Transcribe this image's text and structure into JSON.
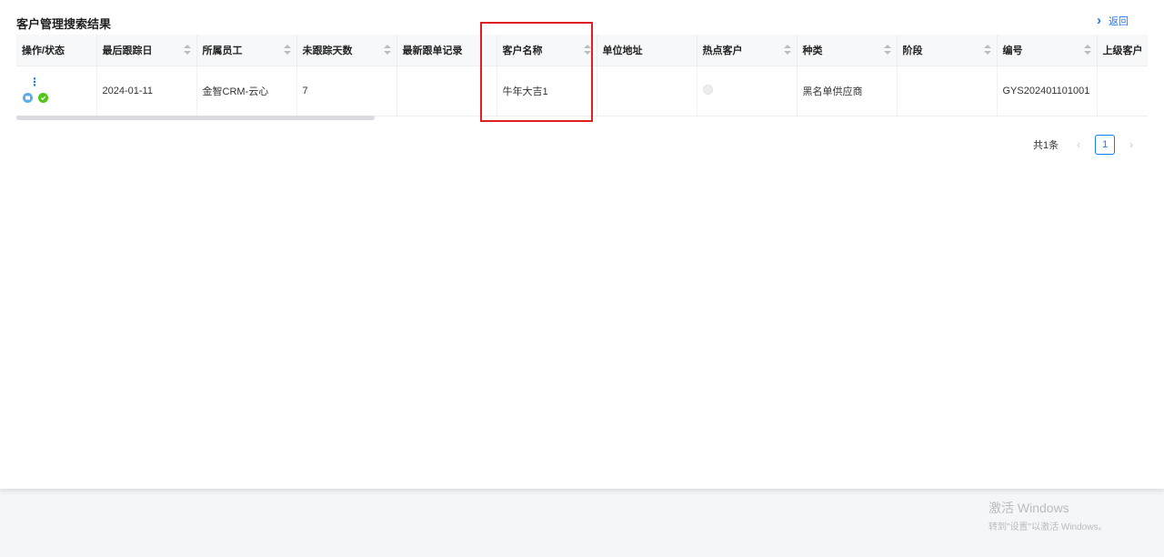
{
  "page": {
    "title": "客户管理搜索结果",
    "back_label": "返回"
  },
  "table": {
    "headers": [
      "操作/状态",
      "最后跟踪日",
      "所属员工",
      "未跟踪天数",
      "最新跟单记录",
      "客户名称",
      "单位地址",
      "热点客户",
      "种类",
      "阶段",
      "编号",
      "上级客户"
    ],
    "sortable": [
      false,
      true,
      true,
      true,
      false,
      true,
      false,
      true,
      true,
      true,
      true,
      false
    ],
    "rows": [
      {
        "last_follow_date": "2024-01-11",
        "employee": "金智CRM-云心",
        "days_not_followed": "7",
        "latest_record": "",
        "customer_name": "牛年大吉1",
        "address": "",
        "category": "黑名单供应商",
        "stage": "",
        "code": "GYS202401101001",
        "parent_customer": ""
      }
    ]
  },
  "pagination": {
    "total_label": "共1条",
    "current_page": "1"
  },
  "watermark": {
    "title": "激活 Windows",
    "subtitle": "转到\"设置\"以激活 Windows。"
  },
  "colors": {
    "accent": "#1677ff",
    "highlight_box": "#e02020",
    "status_ok": "#52c41a",
    "status_info": "#5aaee8"
  }
}
